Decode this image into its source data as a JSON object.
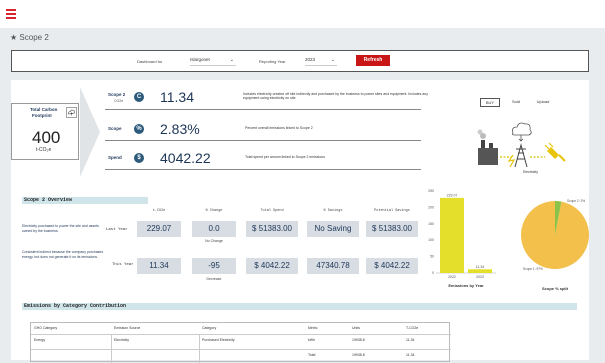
{
  "crumb": "Scope 2",
  "filters": {
    "dashboard_label": "Dashboard for",
    "dashboard_value": "Islargonet",
    "year_label": "Reporting Year",
    "year_value": "2023",
    "refresh_label": "Refresh"
  },
  "total": {
    "label_line1": "Total Carbon",
    "label_line2": "Footprint",
    "value": "400",
    "unit": "t-CO₂e"
  },
  "rows": [
    {
      "label": "Scope 2",
      "sub": "CO2e",
      "icon": "C",
      "value": "11.34",
      "desc": "Includes electricity created off site indirectly and purchased by the business to power sites and equipment. Includes any equipment using electricity on site"
    },
    {
      "label": "Scope",
      "sub": "",
      "icon": "%",
      "value": "2.83%",
      "desc": "Percent overall emissions linked to Scope 2"
    },
    {
      "label": "Spend",
      "sub": "",
      "icon": "$",
      "value": "4042.22",
      "desc": "Total spend per annum linked to Scope 2 emissions"
    }
  ],
  "toggles": [
    "BUY",
    "Sold",
    "Upload"
  ],
  "diagram": {
    "caption": "Electricity"
  },
  "overview": {
    "title": "Scope 2 Overview",
    "columns": [
      "t-CO2e",
      "% Change",
      "Total Spend",
      "% Savings",
      "Potential Savings"
    ],
    "last_label": "Last Year",
    "this_label": "This Year",
    "last_note": "Electricity purchased to power the site and assets owned by the business.",
    "this_note": "Consistent indirect because the company purchases energy, but does not generate it on its emissions.",
    "last": [
      "229.07",
      "0.0",
      "$ 51383.00",
      "No Saving",
      "$ 51383.00"
    ],
    "this": [
      "11.34",
      "-95",
      "$ 4042.22",
      "47340.78",
      "$ 4042.22"
    ],
    "last_change_note": "No Change",
    "this_change_note": "Decrease"
  },
  "emissions_title": "Emissions by Category Contribution",
  "table": {
    "headers": [
      "GHG Category",
      "Emission Source",
      "Category",
      "Metric",
      "Units",
      "T-CO2e"
    ],
    "rows": [
      [
        "Energy",
        "Electricity",
        "Purchased Electricity",
        "kWh",
        "19938.8",
        "11.34"
      ],
      [
        "",
        "",
        "",
        "Total",
        "19938.8",
        "11.34"
      ]
    ]
  },
  "chart_data": [
    {
      "type": "bar",
      "title": "",
      "xlabel": "Emissions by Year",
      "categories": [
        "2022",
        "2023"
      ],
      "values": [
        229.07,
        11.34
      ],
      "data_labels": [
        "229.07",
        "11.34"
      ],
      "yticks": [
        "250",
        "200",
        "150",
        "100",
        "50",
        "0"
      ],
      "ylim": [
        0,
        250
      ],
      "color": "#e3df2a"
    },
    {
      "type": "pie",
      "xlabel": "Scope % split",
      "labels": [
        "Scope 1: 97%",
        "Scope 2: 3%"
      ],
      "values": [
        97,
        3
      ],
      "colors": [
        "#f2c04b",
        "#8bc34a"
      ]
    }
  ]
}
